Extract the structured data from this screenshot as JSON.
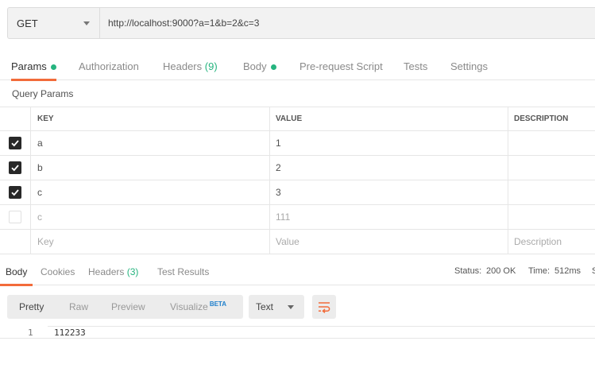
{
  "request": {
    "method": "GET",
    "url": "http://localhost:9000?a=1&b=2&c=3"
  },
  "request_tabs": {
    "params": "Params",
    "authorization": "Authorization",
    "headers": "Headers",
    "headers_count": "(9)",
    "body": "Body",
    "prerequest": "Pre-request Script",
    "tests": "Tests",
    "settings": "Settings",
    "active": "Params"
  },
  "query_params": {
    "title": "Query Params",
    "columns": [
      "KEY",
      "VALUE",
      "DESCRIPTION"
    ],
    "rows": [
      {
        "checked": true,
        "key": "a",
        "value": "1",
        "description": ""
      },
      {
        "checked": true,
        "key": "b",
        "value": "2",
        "description": ""
      },
      {
        "checked": true,
        "key": "c",
        "value": "3",
        "description": ""
      },
      {
        "checked": false,
        "key": "c",
        "value": "111",
        "description": ""
      }
    ],
    "placeholders": {
      "key": "Key",
      "value": "Value",
      "description": "Description"
    }
  },
  "response_tabs": {
    "body": "Body",
    "cookies": "Cookies",
    "headers": "Headers",
    "headers_count": "(3)",
    "test_results": "Test Results",
    "active": "Body"
  },
  "response_status": {
    "status_label": "Status:",
    "status_value": "200 OK",
    "time_label": "Time:",
    "time_value": "512ms",
    "cut_label": "S"
  },
  "response_view": {
    "pretty": "Pretty",
    "raw": "Raw",
    "preview": "Preview",
    "visualize": "Visualize",
    "beta": "BETA",
    "active": "Pretty",
    "format": "Text"
  },
  "response_body": {
    "line_number": "1",
    "content": "112233"
  },
  "colors": {
    "accent": "#f26b3a",
    "success": "#26b47f",
    "beta": "#1f80cc"
  }
}
